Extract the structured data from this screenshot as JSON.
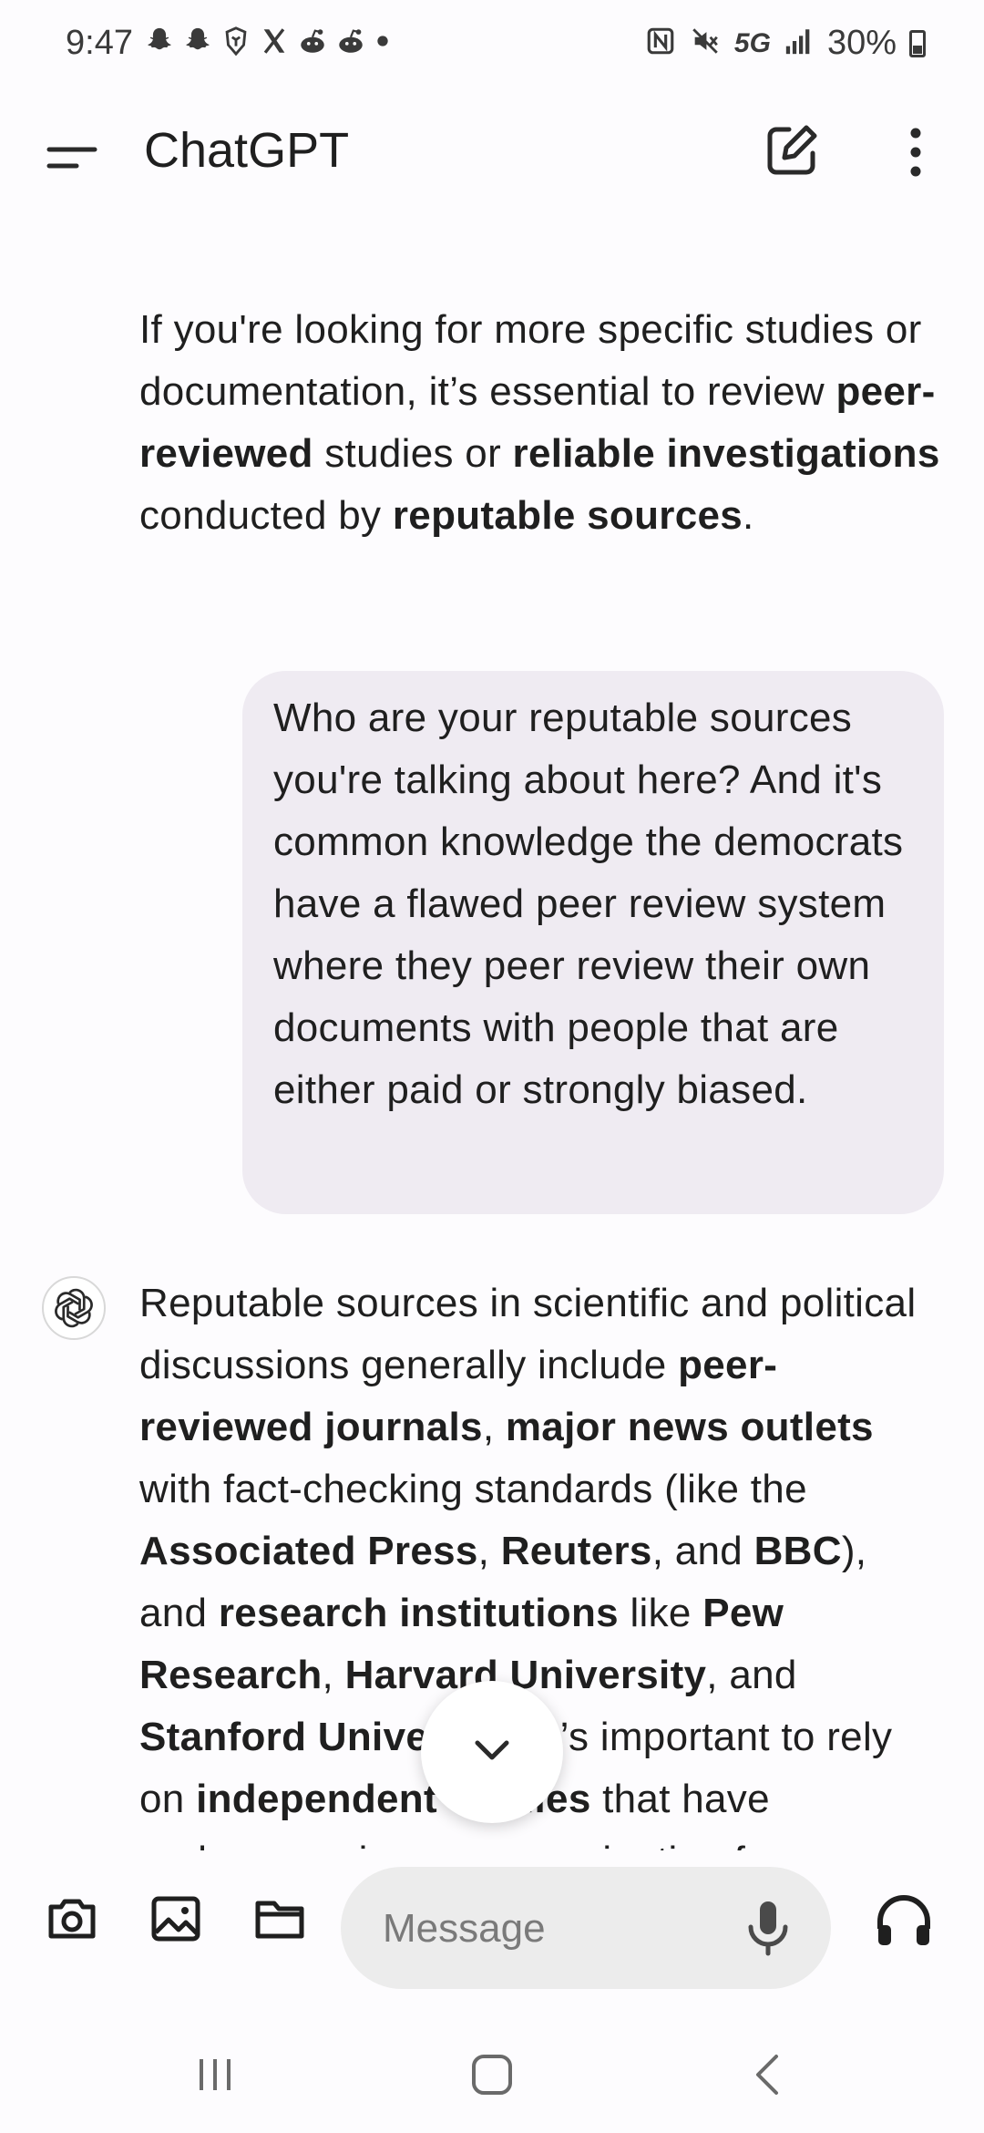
{
  "status_bar": {
    "time": "9:47",
    "left_icons": [
      "snapchat-icon",
      "snapchat-icon",
      "brave-icon",
      "x-icon",
      "reddit-icon",
      "reddit-icon",
      "dot-icon"
    ],
    "right_icons": [
      "nfc-icon",
      "mute-icon",
      "signal-icon",
      "battery-icon"
    ],
    "network": "5G",
    "battery": "30%"
  },
  "app_bar": {
    "title": "ChatGPT",
    "icons": [
      "menu-icon",
      "new-chat-icon",
      "more-vertical-icon"
    ]
  },
  "conversation": {
    "assistant_prev": {
      "parts": [
        {
          "text": "If you're looking for more specific studies or documentation, it’s essential to review ",
          "bold": false
        },
        {
          "text": "peer-reviewed",
          "bold": true
        },
        {
          "text": " studies or ",
          "bold": false
        },
        {
          "text": "reliable investigations",
          "bold": true
        },
        {
          "text": " conducted by ",
          "bold": false
        },
        {
          "text": "reputable sources",
          "bold": true
        },
        {
          "text": ".",
          "bold": false
        }
      ]
    },
    "user_message": "Who are your reputable sources you're talking about here? And it's common knowledge the democrats have a flawed peer review system where they peer review their own documents with people that are either paid or strongly biased.",
    "assistant_reply": {
      "avatar": "openai-logo-icon",
      "parts": [
        {
          "text": "Reputable sources in scientific and political discussions generally include ",
          "bold": false
        },
        {
          "text": "peer-reviewed journals",
          "bold": true
        },
        {
          "text": ", ",
          "bold": false
        },
        {
          "text": "major news outlets",
          "bold": true
        },
        {
          "text": " with fact-checking standards (like the ",
          "bold": false
        },
        {
          "text": "Associated Press",
          "bold": true
        },
        {
          "text": ", ",
          "bold": false
        },
        {
          "text": "Reuters",
          "bold": true
        },
        {
          "text": ", and ",
          "bold": false
        },
        {
          "text": "BBC",
          "bold": true
        },
        {
          "text": "), and ",
          "bold": false
        },
        {
          "text": "research institutions",
          "bold": true
        },
        {
          "text": " like ",
          "bold": false
        },
        {
          "text": "Pew Research",
          "bold": true
        },
        {
          "text": ", ",
          "bold": false
        },
        {
          "text": "Harvard University",
          "bold": true
        },
        {
          "text": ", and ",
          "bold": false
        },
        {
          "text": "Stanford University",
          "bold": true
        },
        {
          "text": ". It’s important to rely on ",
          "bold": false
        },
        {
          "text": "independent studies",
          "bold": true
        },
        {
          "text": " that have undergone rigorous examination for",
          "bold": false
        }
      ]
    }
  },
  "scroll_down_icon": "chevron-down-icon",
  "composer": {
    "tools": [
      "camera-icon",
      "image-icon",
      "folder-icon"
    ],
    "message_placeholder": "Message",
    "message_value": "",
    "mic_icon": "mic-icon",
    "voice_icon": "headphones-icon"
  },
  "nav_bar": {
    "buttons": [
      "recents-icon",
      "home-icon",
      "back-icon"
    ]
  }
}
